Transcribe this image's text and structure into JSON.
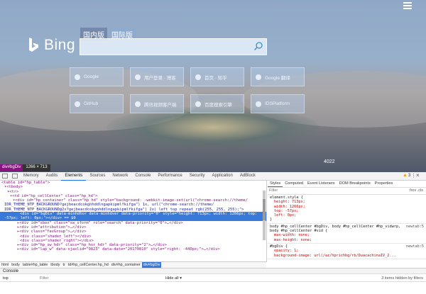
{
  "bing": {
    "logo_text": "Bing",
    "scope_tabs": [
      "国内版",
      "国际版"
    ],
    "search": {
      "value": "",
      "placeholder": ""
    },
    "tiles": [
      {
        "label": "Google",
        "icon": "google-icon"
      },
      {
        "label": "用户登录 · 博客",
        "icon": "user-icon"
      },
      {
        "label": "首页 · 知乎",
        "icon": "zhihu-icon"
      },
      {
        "label": "Google 翻译",
        "icon": "translate-icon"
      },
      {
        "label": "GitHub",
        "icon": "github-icon"
      },
      {
        "label": "腾讯视频客户端",
        "icon": "video-icon"
      },
      {
        "label": "百度搜索引擎",
        "icon": "baidu-icon"
      },
      {
        "label": "IDSPlatform",
        "icon": "platform-icon"
      }
    ],
    "image_counter": "4022"
  },
  "inspect_tooltip": {
    "tag": "div#bgDiv",
    "dims": "1266 × 713"
  },
  "devtools": {
    "tabs": [
      "Memory",
      "Audits",
      "Elements",
      "Sources",
      "Network",
      "Console",
      "Performance",
      "Security",
      "Application",
      "AdBlock"
    ],
    "active_tab": "Elements",
    "warning_count": "3",
    "dom_lines": [
      "<table id=\"hp_table\">",
      "▾<tbody>",
      "▾<tr>",
      "▾<td id=\"hp_cellCenter\" class=\"hp_hd\">",
      "▾<div id=\"hp_container\" class=\"hp_hd\" style=\"background: -webkit-image-set(url(\"chrome-search://theme/",
      "IDR_THEME_NTP_BACKGROUND?gejbeacdcokgnhddlngapkipmlfkifga\") 1x, url(\"chrome-search://theme/",
      "IDR_THEME_NTP_BACKGROUND@2x?gejbeacdcokgnhddlngapkipmlfkifga\") 2x) left top repeat rgb(255, 255, 255);\">",
      "<div id=\"bgDiv\" data-minhdhor data-minhdver data-priority=\"0\" style=\"height: 713px; width: 1266px; top:",
      "-57px; left: 0px;\"></div> == $0",
      "▸<div id=\"sbox\" class=\"sw_sform\" role=\"search\" data-priority=\"0\">…</div>",
      "▸<div id=\"attribution\">…</div>",
      "▸<div class=\"favGroup\">…</div>",
      "<div class=\"shader_left\"></div>",
      "<div class=\"shader_right\"></div>",
      "▸<div id=\"hp_sw_hdr\" class=\"hp_hor_hdr\" data-priority=\"2\">…</div>",
      "▸<div id=\"lap_w\" data-sjaxlid=\"9823\" data-date=\"20170810\" style=\"right: -440px;\">…</div>"
    ],
    "selected_line": 7,
    "breadcrumbs": [
      "html",
      "body",
      "table#hp_table",
      "tbody",
      "tr",
      "td#hp_cellCenter.hp_hd",
      "div#hp_container",
      "div#bgDiv"
    ],
    "styles_tabs": [
      "Styles",
      "Computed",
      "Event Listeners",
      "DOM Breakpoints",
      "Properties"
    ],
    "filter_placeholder": "Filter",
    "hov_cls": ":hov .cls",
    "rules": [
      {
        "selector": "element.style {",
        "props": [
          "height: 713px;",
          "width: 1266px;",
          "top: -57px;",
          "left: 0px;"
        ],
        "source": ""
      },
      {
        "selector": "body #hp_cellCenter #bgDiv, body #hp_cellCenter #hp_vidwrp,",
        "props": [
          "body #hp_cellCenter #vid {",
          "max-width: none;",
          "max-height: none;"
        ],
        "source": "newtab:5"
      },
      {
        "selector": "#bgDiv {",
        "props": [
          "opacity: 1;",
          "background-image: url(/az/hprichbg/rb/DuacachinaIV_2..."
        ],
        "source": "newtab:5"
      }
    ],
    "drawer_title": "Console",
    "console_context": "top",
    "console_filter_placeholder": "Filter",
    "console_levels": "Hide all ▾",
    "hidden_items": "3 items hidden by filters"
  }
}
